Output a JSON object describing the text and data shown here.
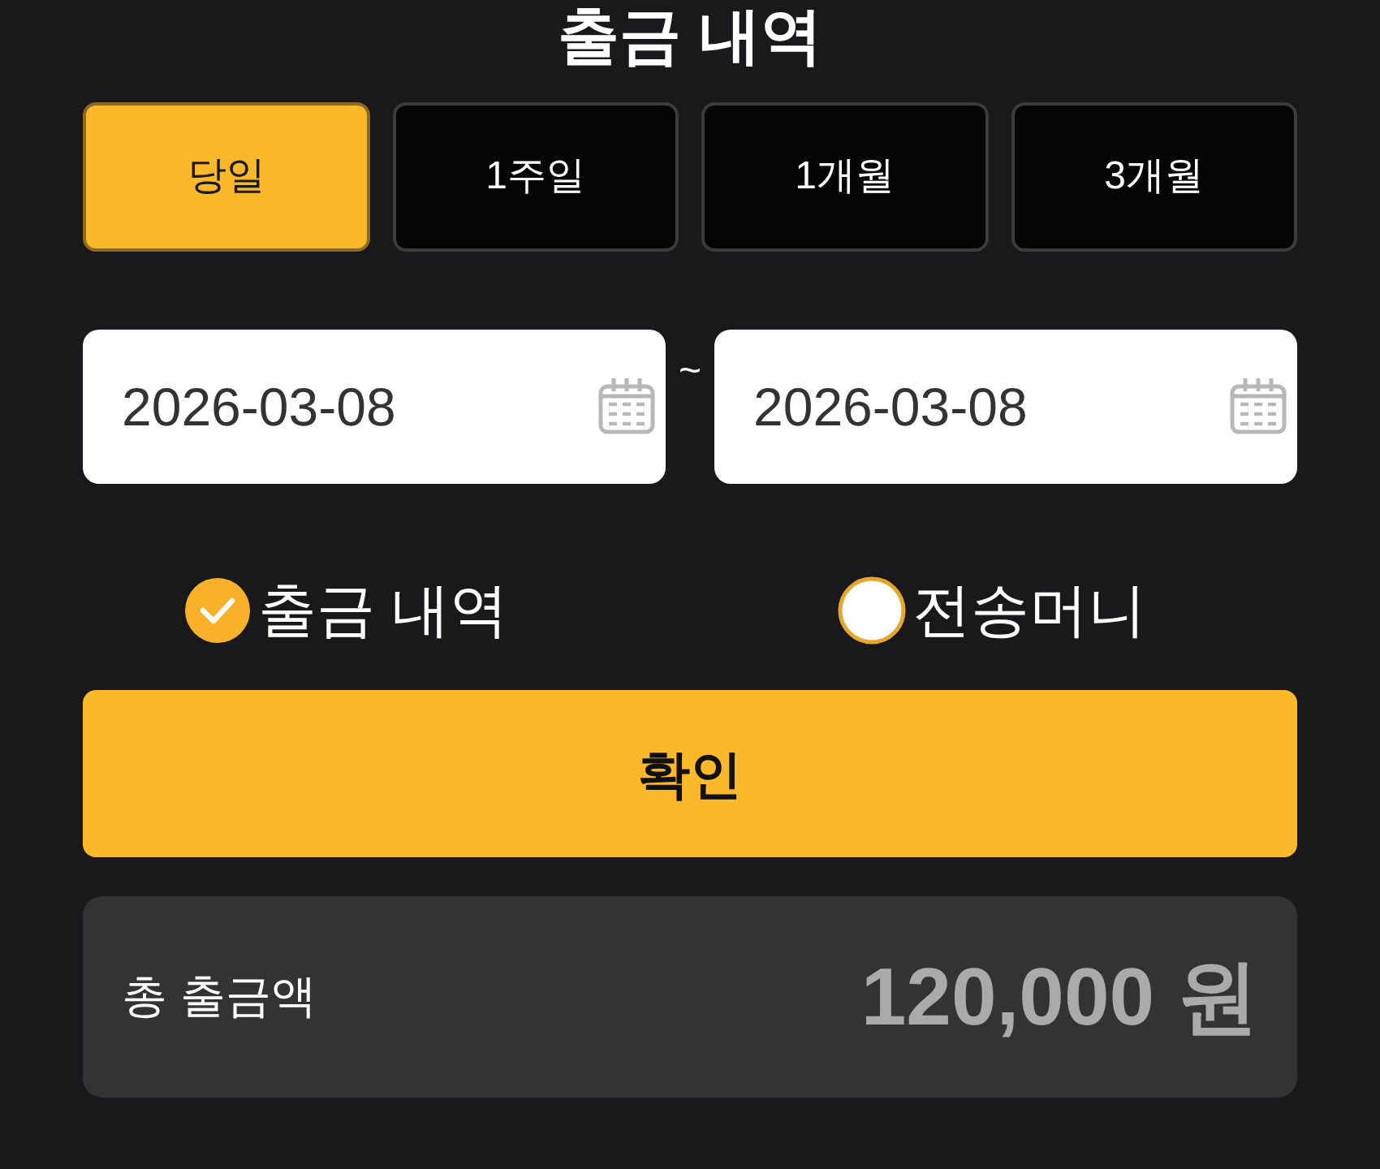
{
  "title": "출금 내역",
  "period_tabs": [
    {
      "label": "당일",
      "selected": true
    },
    {
      "label": "1주일",
      "selected": false
    },
    {
      "label": "1개월",
      "selected": false
    },
    {
      "label": "3개월",
      "selected": false
    }
  ],
  "date_range": {
    "start": "2026-03-08",
    "separator": "~",
    "end": "2026-03-08"
  },
  "options": [
    {
      "label": "출금 내역",
      "selected": true
    },
    {
      "label": "전송머니",
      "selected": false
    }
  ],
  "confirm_button": "확인",
  "summary": {
    "label": "총 출금액",
    "amount": "120,000 원"
  }
}
